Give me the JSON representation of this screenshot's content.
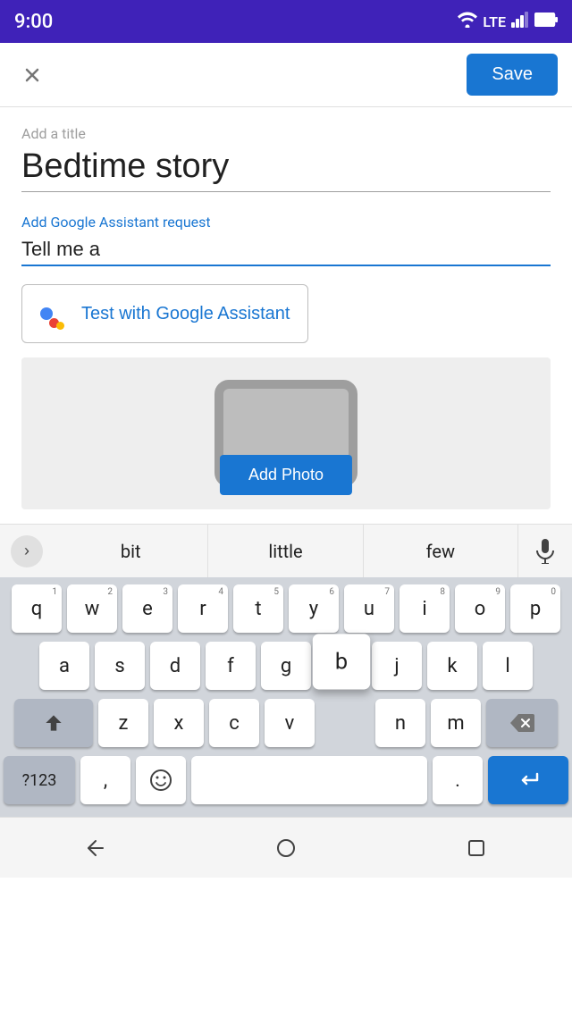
{
  "statusBar": {
    "time": "9:00",
    "lte": "LTE"
  },
  "toolbar": {
    "closeLabel": "×",
    "saveLabel": "Save"
  },
  "form": {
    "titlePlaceholder": "Add a title",
    "titleValue": "Bedtime story",
    "assistantLabel": "Add Google Assistant request",
    "assistantValue": "Tell me a"
  },
  "testButton": {
    "label": "Test with Google Assistant"
  },
  "imageArea": {
    "addPhotoLabel": "Add Photo"
  },
  "suggestions": {
    "items": [
      "bit",
      "little",
      "few"
    ]
  },
  "keyboard": {
    "rows": [
      [
        "q",
        "w",
        "e",
        "r",
        "t",
        "y",
        "u",
        "i",
        "o",
        "p"
      ],
      [
        "a",
        "s",
        "d",
        "f",
        "g",
        "b",
        "j",
        "k",
        "l"
      ],
      [
        "z",
        "x",
        "c",
        "v",
        "n",
        "m"
      ]
    ],
    "nums": [
      "1",
      "2",
      "3",
      "4",
      "5",
      "6",
      "7",
      "8",
      "9",
      "0"
    ],
    "specialLeft": "?123",
    "comma": ",",
    "period": ".",
    "highlightedKey": "b"
  },
  "navBar": {
    "backLabel": "▼",
    "homeLabel": "●",
    "recentLabel": "■"
  }
}
